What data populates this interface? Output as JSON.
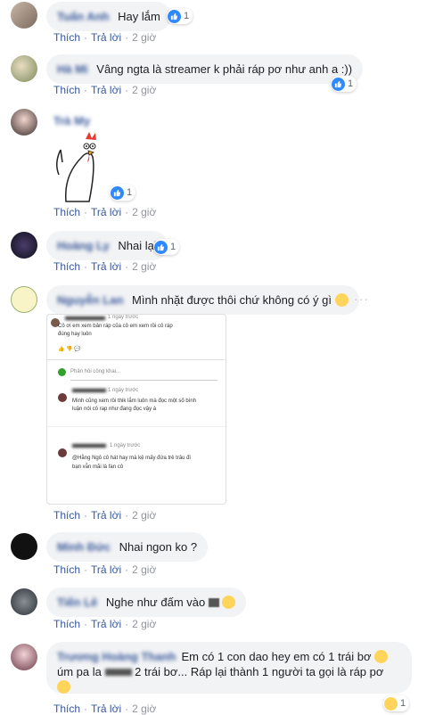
{
  "comments": [
    {
      "text": "Hay lắm",
      "reactions": "1",
      "like_label": "Thích",
      "reply_label": "Trả lời",
      "time": "2 giờ"
    },
    {
      "text": "Vâng ngta là streamer k phải ráp pơ như anh a :))",
      "reactions": "1",
      "like_label": "Thích",
      "reply_label": "Trả lời",
      "time": "2 giờ"
    },
    {
      "text": "",
      "reactions": "1",
      "like_label": "Thích",
      "reply_label": "Trả lời",
      "time": "2 giờ"
    },
    {
      "text": "Nhai lại",
      "reactions": "1",
      "like_label": "Thích",
      "reply_label": "Trả lời",
      "time": "2 giờ"
    },
    {
      "text": "Mình nhặt được thôi chứ không có ý gì",
      "like_label": "Thích",
      "reply_label": "Trả lời",
      "time": "2 giờ"
    },
    {
      "text": "Nhai ngon ko ?",
      "like_label": "Thích",
      "reply_label": "Trả lời",
      "time": "2 giờ"
    },
    {
      "text": "Nghe như đấm vào",
      "like_label": "Thích",
      "reply_label": "Trả lời",
      "time": "2 giờ"
    },
    {
      "text_line1": "Em có 1 con dao hey em có 1 trái bơ",
      "text_line2a": "úm pa la",
      "text_line2b": "2 trái bơ... Ráp lại thành 1 người ta gọi là ráp pơ",
      "reactions": "1",
      "like_label": "Thích",
      "reply_label": "Trả lời",
      "time": "2 giờ"
    }
  ],
  "screenshot": {
    "time1": "1 ngày trước",
    "text1a": "Cô ơi em xem bản ráp của cô em xem rồi cô ráp",
    "text1b": "đúng hay luôn",
    "reply_placeholder": "Phản hồi công khai...",
    "time2": "1 ngày trước",
    "text2a": "Mình cũng xem rồi thik lắm luôn mà đọc một số bình",
    "text2b": "luận nói cô rap như đang đọc vậy á",
    "time3": "1 ngày trước",
    "text3a": "@Hằng Ngô cô hát hay mà kệ  mấy đứa trẻ trâu đi",
    "text3b": "bạn vẫn mãi là fan cô"
  },
  "more_glyph": "···",
  "icons": {
    "like": "like-icon",
    "emoji": "emoji-icon"
  },
  "colors": {
    "link": "#385898",
    "bubble": "#f2f3f5",
    "like": "#2e89ff"
  }
}
